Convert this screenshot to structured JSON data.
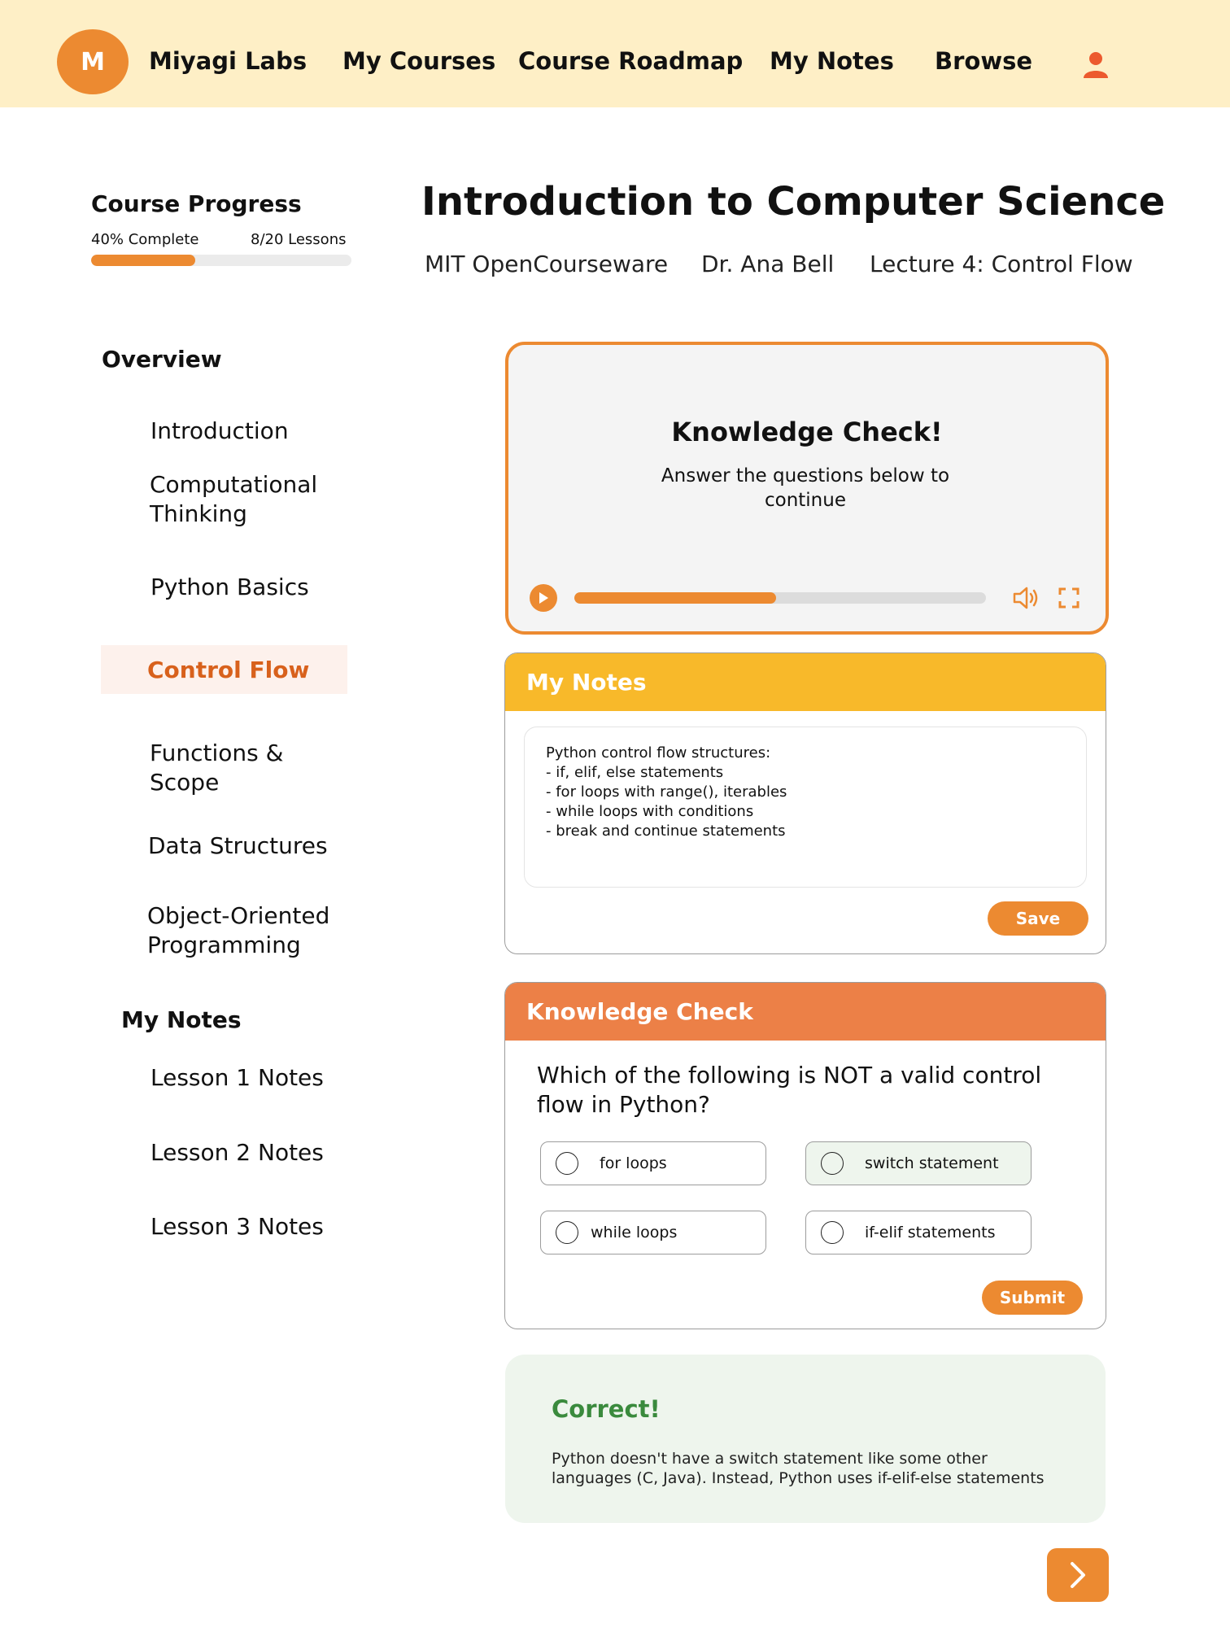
{
  "header": {
    "logo_letter": "M",
    "brand": "Miyagi Labs",
    "nav": [
      "My Courses",
      "Course Roadmap",
      "My Notes",
      "Browse"
    ],
    "user_icon": "user-icon"
  },
  "progress": {
    "title": "Course Progress",
    "percent_label": "40% Complete",
    "lessons_label": "8/20 Lessons",
    "fraction": 0.4
  },
  "course": {
    "title": "Introduction to Computer Science",
    "source": "MIT OpenCourseware",
    "instructor": "Dr. Ana Bell",
    "lecture": "Lecture 4: Control Flow"
  },
  "sidebar": {
    "overview_heading": "Overview",
    "items": [
      "Introduction",
      "Computational Thinking",
      "Python Basics",
      "Control Flow",
      "Functions & Scope",
      "Data Structures",
      "Object-Oriented Programming"
    ],
    "active_item": "Control Flow",
    "notes_heading": "My Notes",
    "notes": [
      "Lesson 1 Notes",
      "Lesson 2 Notes",
      "Lesson 3 Notes"
    ]
  },
  "player": {
    "title": "Knowledge Check!",
    "subtitle": "Answer the questions below to continue",
    "playback_fraction": 0.49,
    "icons": [
      "play-icon",
      "volume-icon",
      "fullscreen-icon"
    ]
  },
  "notes_card": {
    "title": "My Notes",
    "content": "Python control flow structures:\n- if, elif, else statements\n- for loops with range(), iterables\n- while loops with conditions\n- break and continue statements",
    "save_label": "Save",
    "header_color": "#f8b92a"
  },
  "quiz": {
    "title": "Knowledge Check",
    "question": "Which of the following is NOT a valid control flow in Python?",
    "options": [
      "for loops",
      "switch statement",
      "while loops",
      "if-elif statements"
    ],
    "selected": "switch statement",
    "submit_label": "Submit",
    "header_color": "#ec8047"
  },
  "feedback": {
    "title": "Correct!",
    "text": "Python doesn't have a switch statement like some other languages (C, Java). Instead, Python uses if-elif-else statements"
  },
  "colors": {
    "accent": "#ec8a31",
    "header_bg": "#feefc6",
    "success": "#3a8a3d"
  }
}
